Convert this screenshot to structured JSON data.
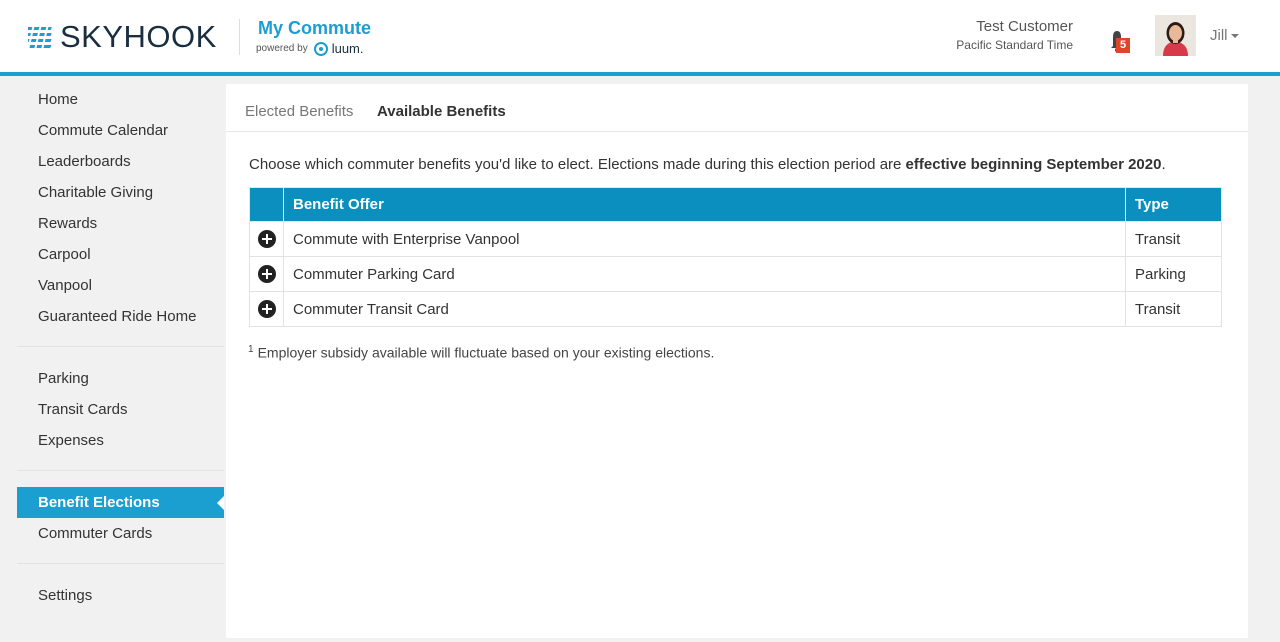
{
  "brand": {
    "logo_text": "SKYHOOK",
    "app_title": "My Commute",
    "powered_by": "powered by",
    "partner": "luum."
  },
  "user": {
    "name": "Test Customer",
    "timezone": "Pacific Standard Time",
    "notifications_count": "5",
    "menu_label": "Jill"
  },
  "sidebar": {
    "group1": [
      {
        "label": "Home"
      },
      {
        "label": "Commute Calendar"
      },
      {
        "label": "Leaderboards"
      },
      {
        "label": "Charitable Giving"
      },
      {
        "label": "Rewards"
      },
      {
        "label": "Carpool"
      },
      {
        "label": "Vanpool"
      },
      {
        "label": "Guaranteed Ride Home"
      }
    ],
    "group2": [
      {
        "label": "Parking"
      },
      {
        "label": "Transit Cards"
      },
      {
        "label": "Expenses"
      }
    ],
    "group3": [
      {
        "label": "Benefit Elections",
        "active": true
      },
      {
        "label": "Commuter Cards"
      }
    ],
    "group4": [
      {
        "label": "Settings"
      }
    ]
  },
  "tabs": {
    "elected": "Elected Benefits",
    "available": "Available Benefits"
  },
  "intro": {
    "text": "Choose which commuter benefits you'd like to elect. Elections made during this election period are ",
    "bold": "effective beginning September 2020",
    "end": "."
  },
  "table": {
    "headers": {
      "offer": "Benefit Offer",
      "type": "Type"
    },
    "rows": [
      {
        "offer": "Commute with Enterprise Vanpool",
        "type": "Transit"
      },
      {
        "offer": "Commuter Parking Card",
        "type": "Parking"
      },
      {
        "offer": "Commuter Transit Card",
        "type": "Transit"
      }
    ]
  },
  "footnote": {
    "mark": "1",
    "text": "Employer subsidy available will fluctuate based on your existing elections."
  },
  "colors": {
    "accent": "#1b9fd0",
    "table_header": "#0a8fbf",
    "badge": "#e0452c"
  }
}
